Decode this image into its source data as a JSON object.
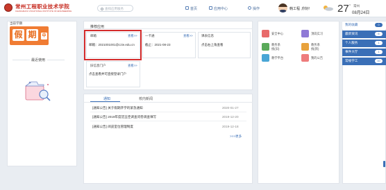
{
  "header": {
    "logo_cn": "常州工程职业技术学院",
    "logo_en": "CHANGZHOU VOCATIONAL INSTITUTE OF ENGINEERING",
    "search_placeholder": "查找应用服务",
    "nav": [
      {
        "label": "首页",
        "icon": "home-icon"
      },
      {
        "label": "应用中心",
        "icon": "grid-icon"
      },
      {
        "label": "操作",
        "icon": "power-icon"
      }
    ],
    "user_name": "韩工程 ,你好!",
    "weather": {
      "temp": "27",
      "unit": "°",
      "city": "常州",
      "date": "08月24日",
      "icon": "cloud-sun-icon"
    }
  },
  "left": {
    "semester_label": "当前学期",
    "holiday_chars": [
      "假",
      "期"
    ],
    "holiday_small": "中",
    "recent_title": "最近使用",
    "empty_icon": "empty-folder-icon"
  },
  "recommend": {
    "title": "推荐应用",
    "cards": [
      {
        "title": "邮箱",
        "more": "查看>>",
        "body": "邮箱：2021001001@czie.edu.cn"
      },
      {
        "title": "一卡通",
        "more": "查看>>",
        "body": "截止：2021-08-23"
      },
      {
        "title": "课表信息",
        "more": "",
        "body": "点击右上角查看"
      },
      {
        "title": "旧信息门户",
        "more": "查看>>",
        "body": "点击查看并可直接登录门户"
      }
    ]
  },
  "notices": {
    "tabs": [
      "通知",
      "校内新闻"
    ],
    "rows": [
      {
        "text": "[通知公告] 关于假期开学的紧急通知",
        "date": "2020-01-27"
      },
      {
        "text": "[通知公告] 2019年度冠五佳调查问卷调查填写",
        "date": "2019-12-20"
      },
      {
        "text": "[通知公告] 阅览室位管理制度",
        "date": "2019-12-18"
      }
    ],
    "more_label": ">>>更多"
  },
  "apps": [
    {
      "label": "安全中心",
      "color": "#e86a6a"
    },
    {
      "label": "顶岗实习",
      "color": "#8f7ad6"
    },
    {
      "label": "教务系统(旧)",
      "color": "#5aaa5a"
    },
    {
      "label": "教务系统(新)",
      "color": "#e8a23c"
    },
    {
      "label": "教学平台",
      "color": "#4aa6d6"
    },
    {
      "label": "我的公告",
      "color": "#ee7c7c"
    }
  ],
  "right_menu": [
    {
      "label": "我的收藏",
      "count": "0",
      "active": false
    },
    {
      "label": "最新资讯",
      "count": "6",
      "active": true
    },
    {
      "label": "个人服务",
      "count": "1",
      "active": false
    },
    {
      "label": "事件大厅",
      "count": "1",
      "active": false
    },
    {
      "label": "常规学工",
      "count": "10",
      "active": false
    }
  ],
  "colors": {
    "accent": "#3a6fb7",
    "highlight": "#d42b2b",
    "holiday": "#f07c33",
    "logo": "#c62a1f"
  }
}
